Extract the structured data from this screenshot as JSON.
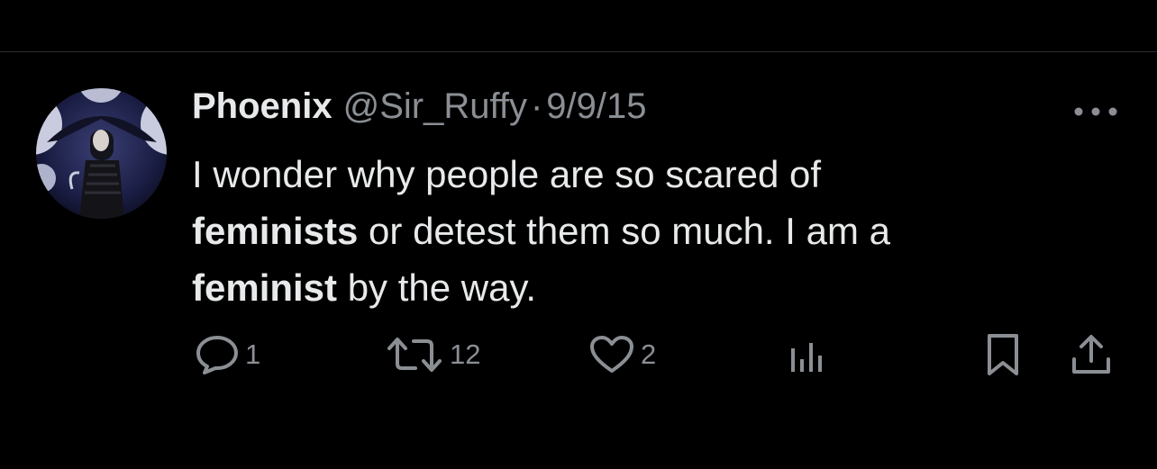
{
  "tweet": {
    "display_name": "Phoenix",
    "handle": "@Sir_Ruffy",
    "separator": "·",
    "date": "9/9/15",
    "text": {
      "line1": "I wonder why people are so scared of",
      "bold1": "feminists",
      "line2_rest": " or detest them so much. I am a",
      "bold2": "feminist",
      "line3_rest": " by the way."
    }
  },
  "actions": {
    "reply_count": "1",
    "retweet_count": "12",
    "like_count": "2"
  },
  "icons": {
    "more": "more-horizontal-icon",
    "reply": "reply-icon",
    "retweet": "retweet-icon",
    "like": "heart-icon",
    "views": "views-icon",
    "bookmark": "bookmark-icon",
    "share": "share-icon"
  },
  "colors": {
    "background": "#000000",
    "primary_text": "#e7e9ea",
    "secondary_text": "#8b8f94",
    "divider": "#2a2d31"
  }
}
